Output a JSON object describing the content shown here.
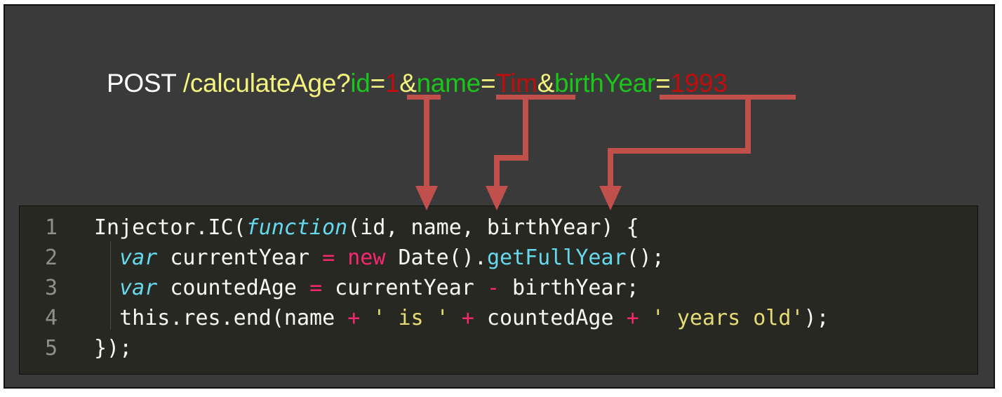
{
  "request": {
    "method": "POST",
    "path": "/calculateAge?",
    "params": [
      {
        "key": "id",
        "eq": "=",
        "value": "1",
        "sep": "&"
      },
      {
        "key": "name",
        "eq": "=",
        "value": "Tim",
        "sep": "&"
      },
      {
        "key": "birthYear",
        "eq": "=",
        "value": "1993",
        "sep": ""
      }
    ]
  },
  "code": {
    "lines": [
      {
        "n": "1",
        "parts": [
          {
            "t": "Injector.IC(",
            "c": ""
          },
          {
            "t": "function",
            "c": "k-fn"
          },
          {
            "t": "(id, name, birthYear) {",
            "c": ""
          }
        ]
      },
      {
        "n": "2",
        "parts": [
          {
            "t": "  ",
            "c": ""
          },
          {
            "t": "var",
            "c": "k-var"
          },
          {
            "t": " currentYear ",
            "c": ""
          },
          {
            "t": "=",
            "c": "k-op"
          },
          {
            "t": " ",
            "c": ""
          },
          {
            "t": "new",
            "c": "k-op"
          },
          {
            "t": " Date().",
            "c": ""
          },
          {
            "t": "getFullYear",
            "c": "k-call"
          },
          {
            "t": "();",
            "c": ""
          }
        ]
      },
      {
        "n": "3",
        "parts": [
          {
            "t": "  ",
            "c": ""
          },
          {
            "t": "var",
            "c": "k-var"
          },
          {
            "t": " countedAge ",
            "c": ""
          },
          {
            "t": "=",
            "c": "k-op"
          },
          {
            "t": " currentYear ",
            "c": ""
          },
          {
            "t": "-",
            "c": "k-op"
          },
          {
            "t": " birthYear;",
            "c": ""
          }
        ]
      },
      {
        "n": "4",
        "parts": [
          {
            "t": "  this.res.end(name ",
            "c": ""
          },
          {
            "t": "+",
            "c": "k-op"
          },
          {
            "t": " ",
            "c": ""
          },
          {
            "t": "' is '",
            "c": "k-str"
          },
          {
            "t": " ",
            "c": ""
          },
          {
            "t": "+",
            "c": "k-op"
          },
          {
            "t": " countedAge ",
            "c": ""
          },
          {
            "t": "+",
            "c": "k-op"
          },
          {
            "t": " ",
            "c": ""
          },
          {
            "t": "' years old'",
            "c": "k-str"
          },
          {
            "t": ");",
            "c": ""
          }
        ]
      },
      {
        "n": "5",
        "parts": [
          {
            "t": "});",
            "c": ""
          }
        ]
      }
    ]
  },
  "colors": {
    "arrow": "#c1504c",
    "background": "#3a3a3a",
    "editor_background": "#272822"
  }
}
